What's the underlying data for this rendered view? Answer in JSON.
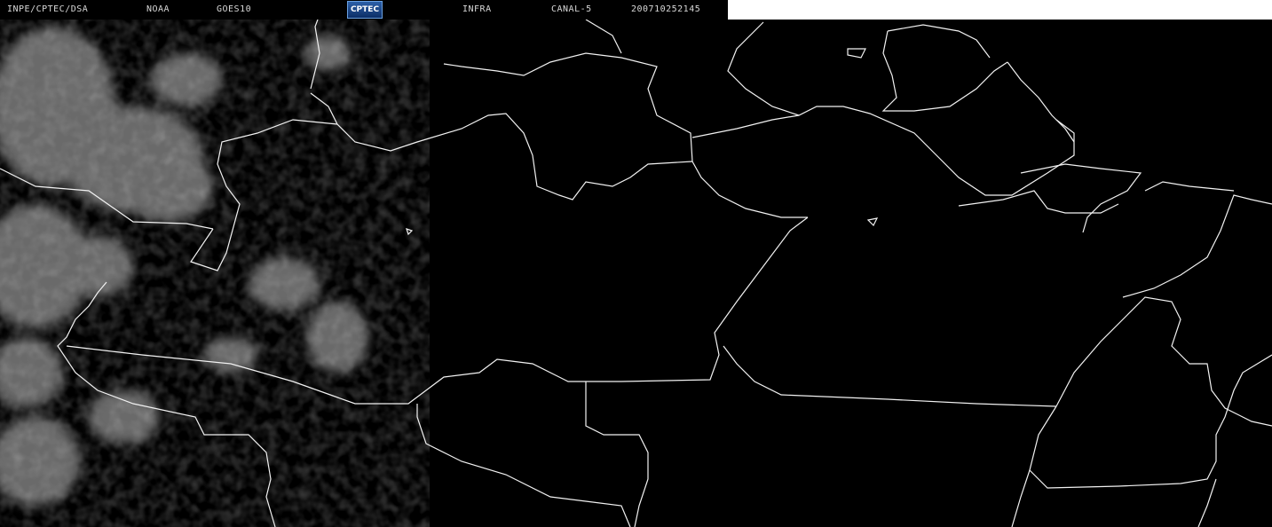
{
  "header": {
    "source": "INPE/CPTEC/DSA",
    "agency": "NOAA",
    "satellite": "GOES10",
    "logo_text": "CPTEC",
    "band": "INFRA",
    "channel": "CANAL-5",
    "timestamp": "200710252145"
  },
  "colors": {
    "background": "#000000",
    "borders": "#f2f2f2",
    "clouds": "#9a9a9a",
    "header_text": "#d8d8d8",
    "header_right_bg": "#ffffff"
  }
}
